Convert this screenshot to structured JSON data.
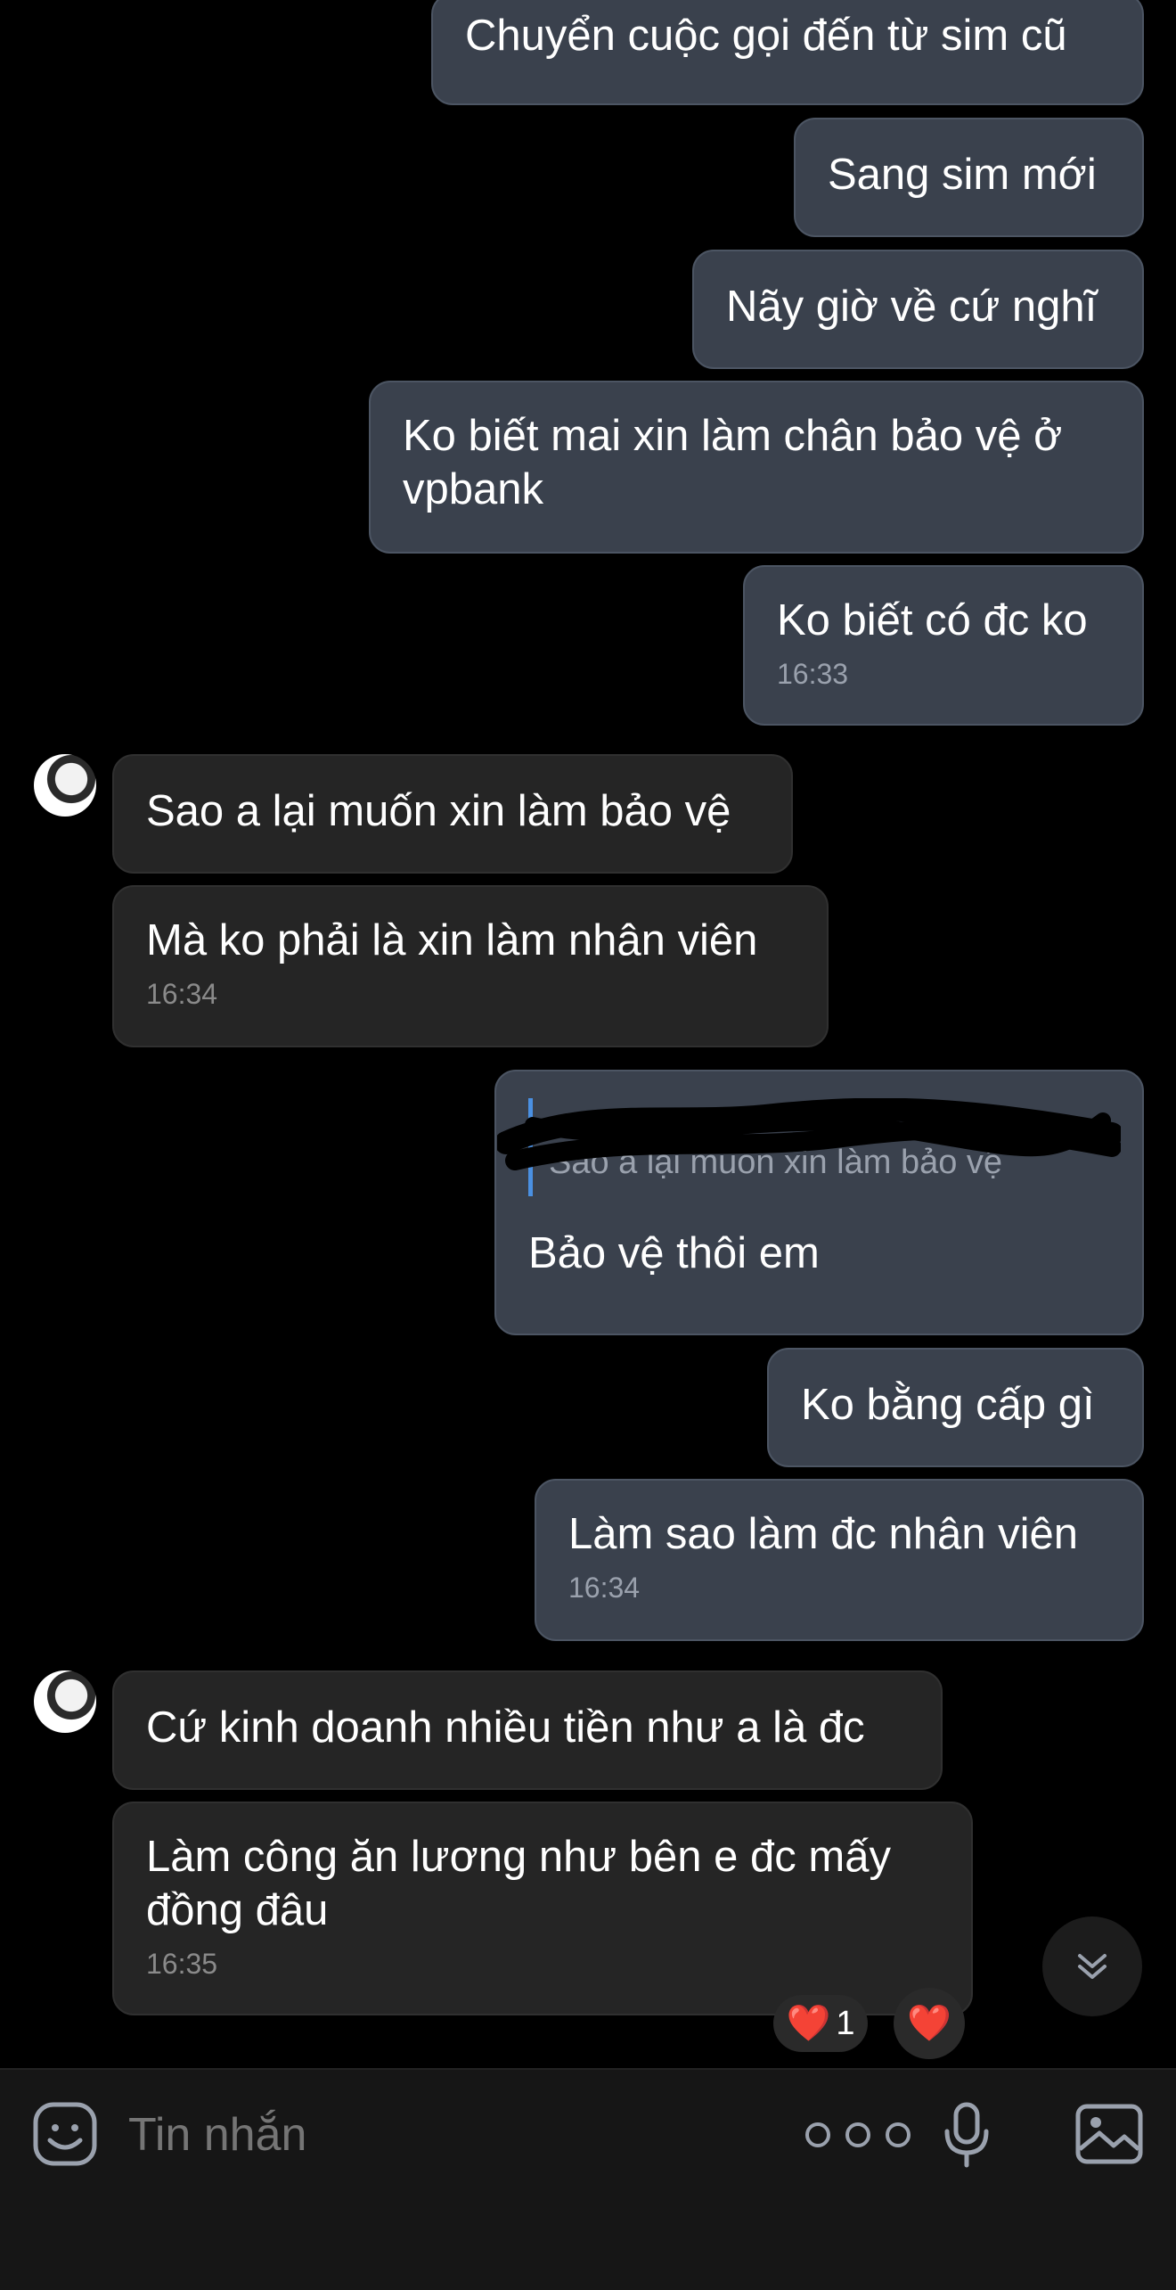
{
  "messages": [
    {
      "dir": "out",
      "text": "Chuyển cuộc gọi đến từ sim cũ"
    },
    {
      "dir": "out",
      "text": "Sang sim mới"
    },
    {
      "dir": "out",
      "text": "Nãy giờ về cứ nghĩ"
    },
    {
      "dir": "out",
      "text": "Ko biết mai xin làm chân bảo vệ ở vpbank"
    },
    {
      "dir": "out",
      "text": "Ko biết có đc ko",
      "time": "16:33"
    },
    {
      "dir": "in",
      "text": "Sao a lại muốn xin làm bảo vệ"
    },
    {
      "dir": "in",
      "text": "Mà ko phải là xin làm nhân viên",
      "time": "16:34"
    },
    {
      "dir": "out",
      "reply_to": "Sao a lại muốn xin làm bảo vệ",
      "text": "Bảo vệ thôi em"
    },
    {
      "dir": "out",
      "text": "Ko bằng cấp gì"
    },
    {
      "dir": "out",
      "text": "Làm sao làm đc nhân viên",
      "time": "16:34"
    },
    {
      "dir": "in",
      "text": "Cứ kinh doanh nhiều tiền như a là đc"
    },
    {
      "dir": "in",
      "text": "Làm công ăn lương như bên e đc mấy đồng đâu",
      "time": "16:35"
    }
  ],
  "reactions": {
    "count_badge": {
      "emoji": "❤️",
      "count": "1"
    },
    "add_heart": "❤️"
  },
  "input": {
    "placeholder": "Tin nhắn"
  },
  "colors": {
    "background": "#000000",
    "outgoing_bubble": "#3a414d",
    "incoming_bubble": "#252525",
    "reply_bar": "#4a90e2",
    "reaction_heart": "#e0245e"
  },
  "icons": [
    "emoji-icon",
    "more-icon",
    "microphone-icon",
    "gallery-icon",
    "scroll-down-icon"
  ]
}
